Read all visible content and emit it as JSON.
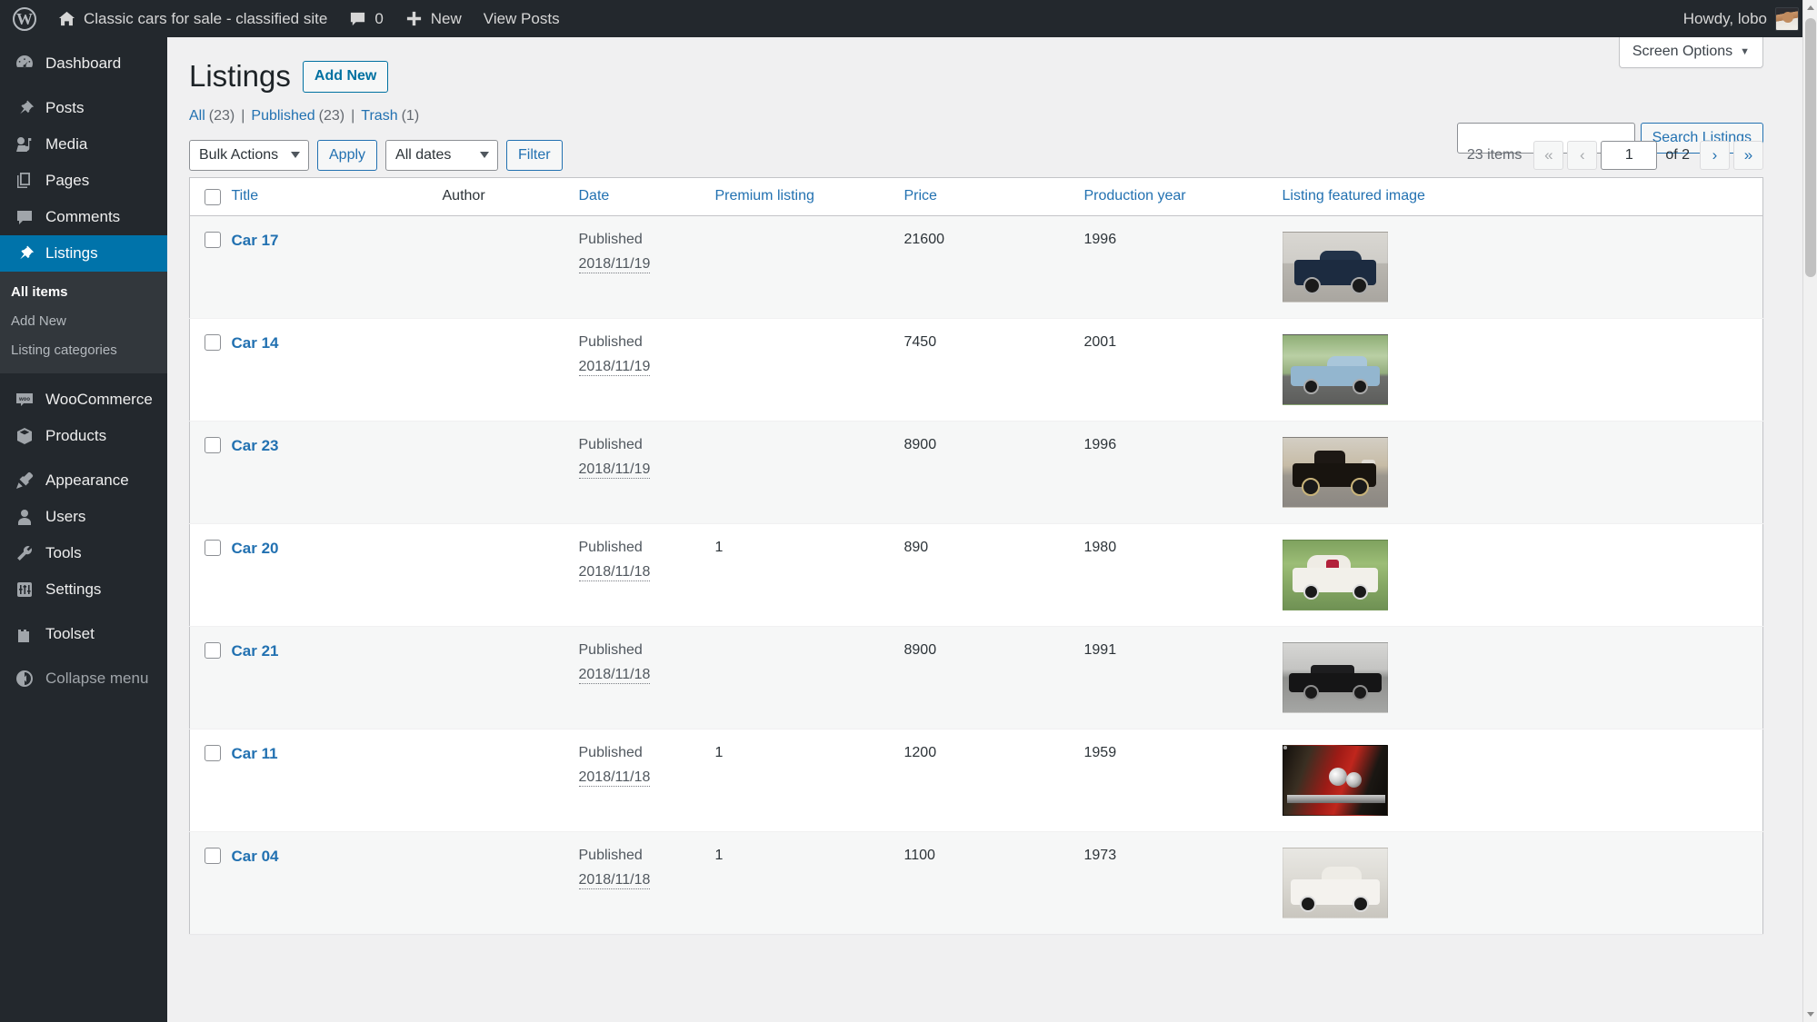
{
  "adminbar": {
    "wp_logo": "wordpress-logo-icon",
    "site_title": "Classic cars for sale - classified site",
    "comments_count": "0",
    "new_label": "New",
    "view_posts_label": "View Posts",
    "howdy": "Howdy, lobo"
  },
  "sidebar": {
    "items": [
      {
        "label": "Dashboard",
        "icon": "dashboard-icon",
        "current": false
      },
      {
        "label": "Posts",
        "icon": "pin-icon",
        "current": false
      },
      {
        "label": "Media",
        "icon": "media-icon",
        "current": false
      },
      {
        "label": "Pages",
        "icon": "pages-icon",
        "current": false
      },
      {
        "label": "Comments",
        "icon": "comment-icon",
        "current": false
      },
      {
        "label": "Listings",
        "icon": "pin-icon",
        "current": true
      },
      {
        "label": "WooCommerce",
        "icon": "woo-icon",
        "current": false
      },
      {
        "label": "Products",
        "icon": "box-icon",
        "current": false
      },
      {
        "label": "Appearance",
        "icon": "brush-icon",
        "current": false
      },
      {
        "label": "Users",
        "icon": "user-icon",
        "current": false
      },
      {
        "label": "Tools",
        "icon": "wrench-icon",
        "current": false
      },
      {
        "label": "Settings",
        "icon": "sliders-icon",
        "current": false
      },
      {
        "label": "Toolset",
        "icon": "toolset-icon",
        "current": false
      },
      {
        "label": "Collapse menu",
        "icon": "collapse-icon",
        "current": false
      }
    ],
    "submenu": [
      {
        "label": "All items",
        "current": true
      },
      {
        "label": "Add New",
        "current": false
      },
      {
        "label": "Listing categories",
        "current": false
      }
    ]
  },
  "screen_meta": {
    "screen_options_label": "Screen Options"
  },
  "header": {
    "title": "Listings",
    "add_new_label": "Add New"
  },
  "views": [
    {
      "label": "All",
      "count": "(23)"
    },
    {
      "label": "Published",
      "count": "(23)"
    },
    {
      "label": "Trash",
      "count": "(1)"
    }
  ],
  "search": {
    "value": "",
    "placeholder": "",
    "submit_label": "Search Listings"
  },
  "toolbar": {
    "bulk_actions_label": "Bulk Actions",
    "apply_label": "Apply",
    "dates_label": "All dates",
    "filter_label": "Filter"
  },
  "pagination": {
    "displaying_num": "23 items",
    "first_label": "«",
    "prev_label": "‹",
    "current_page": "1",
    "total_label": "of 2",
    "next_label": "›",
    "last_label": "»"
  },
  "table": {
    "columns": [
      {
        "key": "cb",
        "label": ""
      },
      {
        "key": "title",
        "label": "Title",
        "sortable": true
      },
      {
        "key": "author",
        "label": "Author",
        "sortable": false
      },
      {
        "key": "date",
        "label": "Date",
        "sortable": true
      },
      {
        "key": "premium",
        "label": "Premium listing",
        "sortable": true
      },
      {
        "key": "price",
        "label": "Price",
        "sortable": true
      },
      {
        "key": "year",
        "label": "Production year",
        "sortable": true
      },
      {
        "key": "image",
        "label": "Listing featured image",
        "sortable": true
      }
    ],
    "rows": [
      {
        "title": "Car 17",
        "author": "",
        "status": "Published",
        "date": "2018/11/19",
        "premium": "",
        "price": "21600",
        "year": "1996",
        "thumb": "t-car17",
        "thumb_alt": "dark-blue-classic-coupe-thumbnail"
      },
      {
        "title": "Car 14",
        "author": "",
        "status": "Published",
        "date": "2018/11/19",
        "premium": "",
        "price": "7450",
        "year": "2001",
        "thumb": "t-car14",
        "thumb_alt": "light-blue-thunderbird-thumbnail"
      },
      {
        "title": "Car 23",
        "author": "",
        "status": "Published",
        "date": "2018/11/19",
        "premium": "",
        "price": "8900",
        "year": "1996",
        "thumb": "t-car23",
        "thumb_alt": "black-hot-rod-thumbnail"
      },
      {
        "title": "Car 20",
        "author": "",
        "status": "Published",
        "date": "2018/11/18",
        "premium": "1",
        "price": "890",
        "year": "1980",
        "thumb": "t-car20",
        "thumb_alt": "white-wedding-car-thumbnail"
      },
      {
        "title": "Car 21",
        "author": "",
        "status": "Published",
        "date": "2018/11/18",
        "premium": "",
        "price": "8900",
        "year": "1991",
        "thumb": "t-car21",
        "thumb_alt": "black-sedan-thumbnail"
      },
      {
        "title": "Car 11",
        "author": "",
        "status": "Published",
        "date": "2018/11/18",
        "premium": "1",
        "price": "1200",
        "year": "1959",
        "thumb": "t-car11",
        "thumb_alt": "red-car-headlight-closeup-thumbnail"
      },
      {
        "title": "Car 04",
        "author": "",
        "status": "Published",
        "date": "2018/11/18",
        "premium": "1",
        "price": "1100",
        "year": "1973",
        "thumb": "t-car04",
        "thumb_alt": "white-classic-car-thumbnail"
      }
    ]
  },
  "colors": {
    "admin_dark": "#23282d",
    "admin_submenu": "#32373c",
    "accent_blue": "#0073aa",
    "link_blue": "#2271b1",
    "page_bg": "#f0f0f1",
    "row_alt": "#f6f7f7"
  }
}
